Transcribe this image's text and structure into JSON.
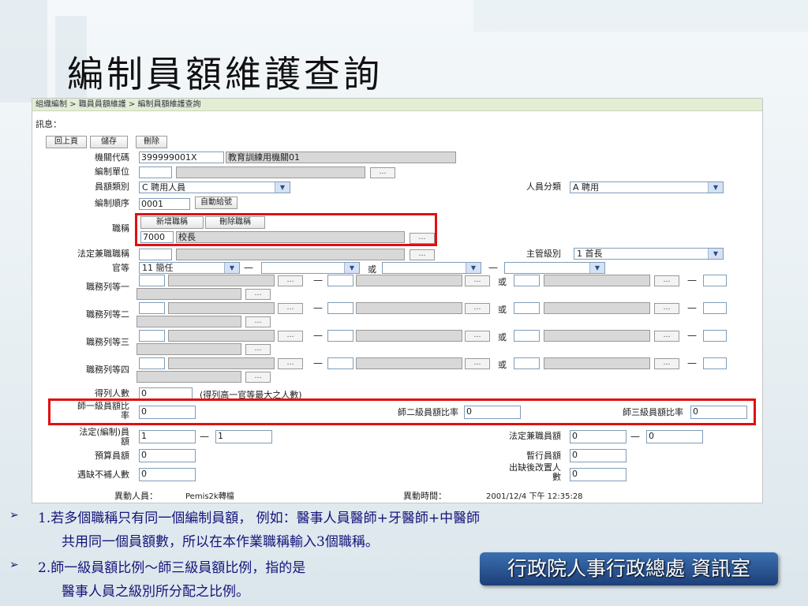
{
  "slide_title": "編制員額維護查詢",
  "breadcrumb": "組織編制 > 職員員額維護 > 編制員額維護查詢",
  "message_label": "訊息：",
  "toolbar": {
    "back": "回上頁",
    "save": "儲存",
    "delete": "刪除"
  },
  "ellipsis": "…",
  "dash": "—",
  "or": "或",
  "dropdown_arrow": "▼",
  "fields": {
    "agency_code": {
      "label": "機關代碼",
      "code": "399999001X",
      "name": "教育訓練用機關01"
    },
    "unit": {
      "label": "編制單位",
      "code": "",
      "name": ""
    },
    "quota_type": {
      "label": "員額類別",
      "value": "C 聘用人員"
    },
    "personnel_class": {
      "label": "人員分類",
      "value": "A 聘用"
    },
    "sequence": {
      "label": "編制順序",
      "value": "0001",
      "button": "自動給號"
    },
    "title": {
      "label": "職稱",
      "add_button": "新增職稱",
      "remove_button": "刪除職稱",
      "code": "7000",
      "name": "校長"
    },
    "concurrent_title": {
      "label": "法定兼職職稱",
      "code": "",
      "name": ""
    },
    "supervisor_level": {
      "label": "主管級別",
      "value": "1 首長"
    },
    "rank": {
      "label": "官等",
      "value": "11 簡任",
      "value2": "",
      "value3": "",
      "value4": ""
    },
    "grade_rows": [
      {
        "label": "職務列等一"
      },
      {
        "label": "職務列等二"
      },
      {
        "label": "職務列等三"
      },
      {
        "label": "職務列等四"
      }
    ],
    "count": {
      "label": "得列人數",
      "value": "0",
      "note": "(得列高一官等最大之人數)"
    },
    "ratio1": {
      "label_line1": "師一級員額比",
      "label_line2": "率",
      "value": "0"
    },
    "ratio2": {
      "label": "師二級員額比率",
      "value": "0"
    },
    "ratio3": {
      "label": "師三級員額比率",
      "value": "0"
    },
    "legal_quota": {
      "label_line1": "法定(編制)員",
      "label_line2": "額",
      "value1": "1",
      "value2": "1"
    },
    "legal_concurrent": {
      "label": "法定兼職員額",
      "value1": "0",
      "value2": "0"
    },
    "budget": {
      "label": "預算員額",
      "value": "0"
    },
    "temp": {
      "label": "暫行員額",
      "value": "0"
    },
    "vacancy": {
      "label": "遇缺不補人數",
      "value": "0"
    },
    "post_vacancy": {
      "label_line1": "出缺後改置人",
      "label_line2": "數",
      "value": "0"
    }
  },
  "footer": {
    "changer_label": "異動人員：",
    "changer": "Pemis2k轉檔",
    "time_label": "異動時間：",
    "time": "2001/12/4 下午 12:35:28"
  },
  "notes": [
    {
      "line1": "1.若多個職稱只有同一個編制員額， 例如：醫事人員醫師+牙醫師+中醫師",
      "line2": "共用同一個員額數，所以在本作業職稱輸入3個職稱。"
    },
    {
      "line1": "2.師一級員額比例～師三級員額比例，指的是",
      "line2": "醫事人員之級別所分配之比例。"
    }
  ],
  "bullet_glyph": "➢",
  "org_label": "行政院人事行政總處 資訊室"
}
